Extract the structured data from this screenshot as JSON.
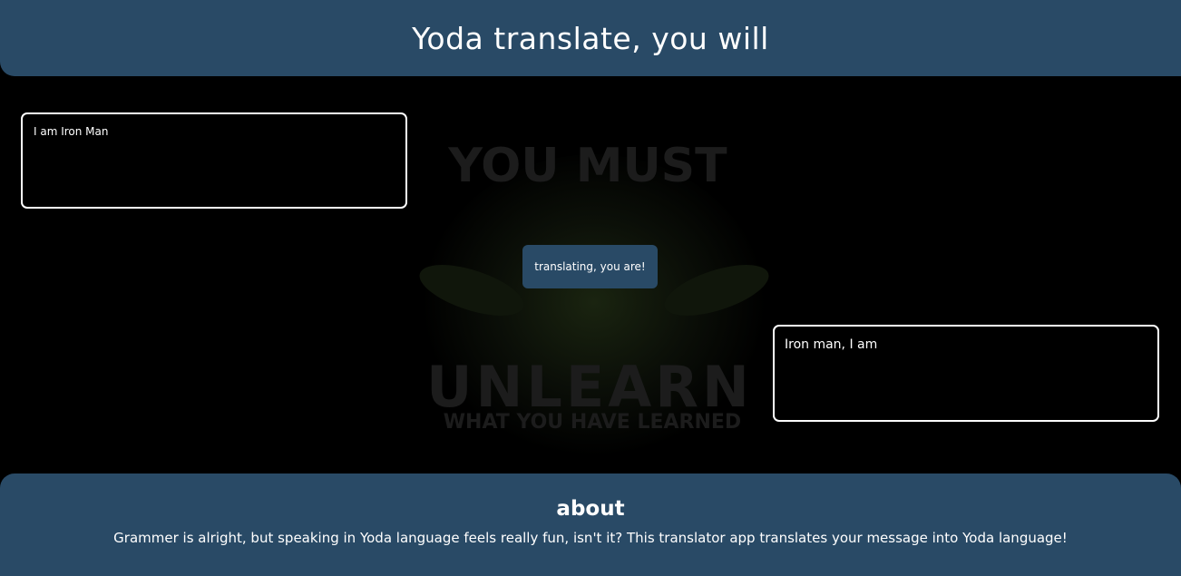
{
  "header": {
    "title": "Yoda translate, you will"
  },
  "background": {
    "line1": "YOU MUST",
    "line2": "UNLEARN",
    "line3": "WHAT YOU HAVE LEARNED"
  },
  "input": {
    "value": "I am Iron Man"
  },
  "translate_button": {
    "label": "translating, you are!"
  },
  "output": {
    "text": "Iron man, I am"
  },
  "footer": {
    "heading": "about",
    "description": "Grammer is alright, but speaking in Yoda language feels really fun, isn't it? This translator app translates your message into Yoda language!"
  },
  "colors": {
    "primary": "#294a66",
    "background": "#000000",
    "text": "#ffffff"
  }
}
